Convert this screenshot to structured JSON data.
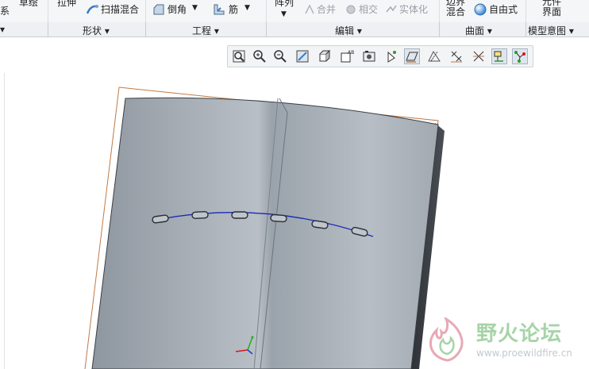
{
  "ribbon": {
    "items": {
      "xi": "系",
      "caohui": "草绘",
      "lashen": "拉伸",
      "saomiao": "扫描混合",
      "daojiao": "倒角",
      "jin": "筋",
      "zhenlie": "阵列",
      "hebing": "合并",
      "xiangjiao": "相交",
      "shitihua": "实体化",
      "bianjie_top": "边界",
      "bianjie_bottom": "混合",
      "ziyoushi": "自由式",
      "yuanjian_top": "元件",
      "yuanjian_bottom": "界面"
    },
    "groups": {
      "xingzhuang": "形状",
      "gongcheng": "工程",
      "bianji": "编辑",
      "qumian": "曲面",
      "moxingyitu": "模型意图"
    }
  },
  "view_toolbar": {
    "buttons": [
      {
        "icon": "refit-icon",
        "active": false
      },
      {
        "icon": "zoom-in-icon",
        "active": false
      },
      {
        "icon": "zoom-out-icon",
        "active": false
      },
      {
        "icon": "repaint-icon",
        "active": false
      },
      {
        "icon": "display-style-icon",
        "active": false
      },
      {
        "icon": "saved-orientations-icon",
        "active": false
      },
      {
        "icon": "view-manager-icon",
        "active": false
      },
      {
        "icon": "spin-center-icon",
        "active": false
      },
      {
        "icon": "datum-plane-display-icon",
        "active": true
      },
      {
        "icon": "datum-axis-display-icon",
        "active": false
      },
      {
        "icon": "point-display-icon",
        "active": false
      },
      {
        "icon": "csys-display-icon",
        "active": false
      },
      {
        "icon": "annotation-display-icon",
        "active": true
      },
      {
        "icon": "appearance-icon",
        "active": true
      }
    ]
  },
  "watermark": {
    "title": "野火论坛",
    "url": "www.proewildfire.cn"
  },
  "colors": {
    "ribbon_bg": "#f5f6f8",
    "model_surface": "#a9b1b9",
    "model_edge": "#3a3f45",
    "datum_frame": "#c07a45",
    "curve": "#1a28b8"
  }
}
